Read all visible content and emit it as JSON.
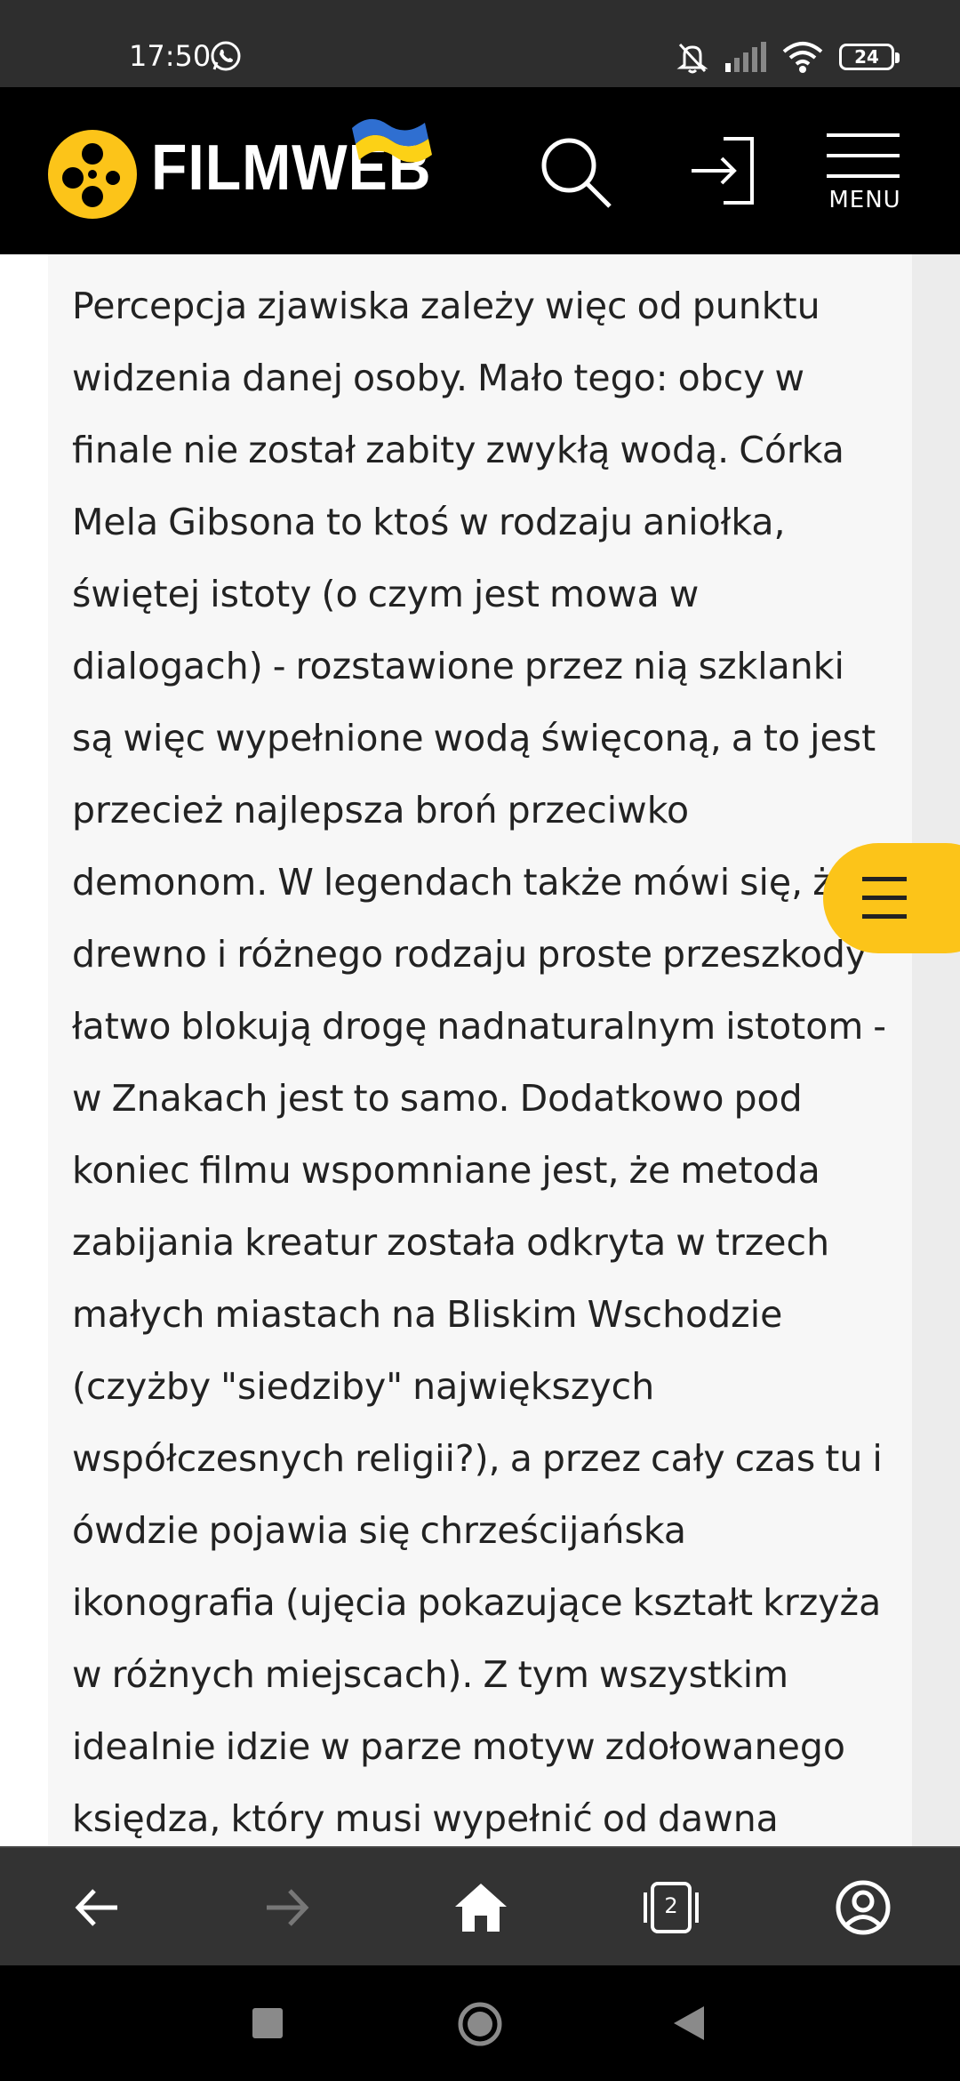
{
  "status_bar": {
    "time": "17:50",
    "battery": "24",
    "icons": [
      "whatsapp-icon",
      "mute-icon",
      "signal-icon",
      "wifi-icon",
      "battery-icon"
    ]
  },
  "header": {
    "logo_text": "FILMWEB",
    "menu_label": "MENU",
    "brand_color": "#fcc419",
    "icons": [
      "search-icon",
      "login-icon",
      "menu-icon"
    ]
  },
  "article": {
    "text": "Percepcja zjawiska zależy więc od punktu widzenia danej osoby. Mało tego: obcy w finale nie został zabity zwykłą wodą. Córka Mela Gibsona to ktoś w rodzaju aniołka, świętej istoty (o czym jest mowa w dialogach) - rozstawione przez nią szklanki są więc wypełnione wodą święconą, a to jest przecież najlepsza broń przeciwko demonom. W legendach także mówi się, że drewno i różnego rodzaju proste przeszkody łatwo blokują drogę nadnaturalnym istotom - w Znakach jest to samo. Dodatkowo pod koniec filmu wspomniane jest, że metoda zabijania kreatur została odkryta w trzech małych miastach na Bliskim Wschodzie (czyżby \"siedziby\" największych współczesnych religii?), a przez cały czas tu i ówdzie pojawia się chrześcijańska ikonografia (ujęcia pokazujące kształt krzyża w różnych miejscach). Z tym wszystkim idealnie idzie w parze motyw zdołowanego księdza, który musi wypełnić od dawna"
  },
  "browser_bar": {
    "tab_count": "2",
    "buttons": [
      "back-icon",
      "forward-icon",
      "home-icon",
      "tabs-icon",
      "account-icon"
    ]
  },
  "system_nav": {
    "buttons": [
      "recents-icon",
      "home-circle-icon",
      "back-triangle-icon"
    ]
  }
}
